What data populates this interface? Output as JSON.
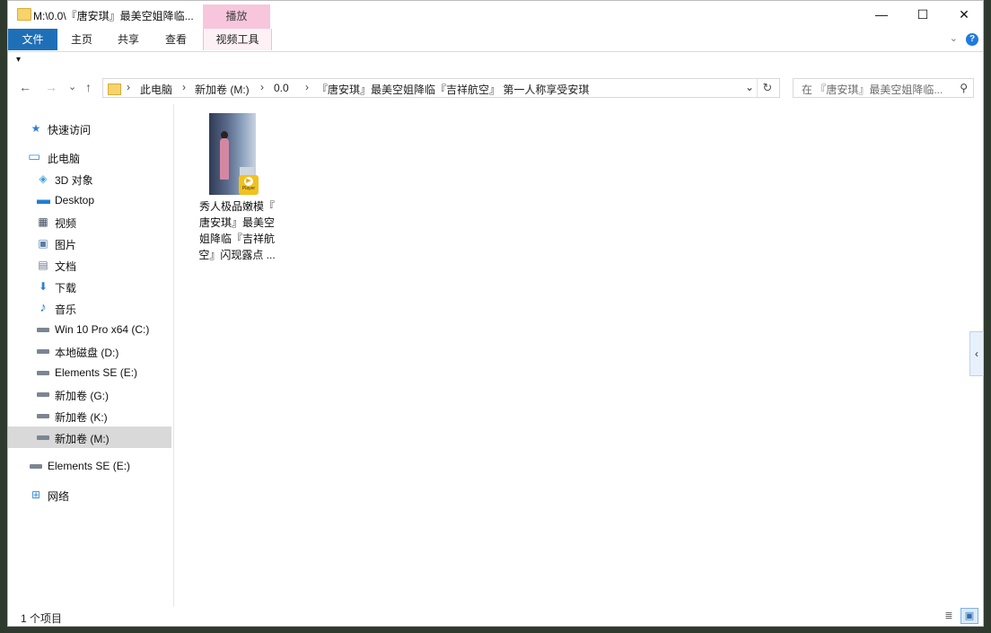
{
  "window": {
    "title": "M:\\0.0\\『唐安琪』最美空姐降临...",
    "context_tab": "播放",
    "controls": {
      "minimize": "—",
      "maximize": "☐",
      "close": "✕"
    }
  },
  "ribbon": {
    "tabs": [
      "文件",
      "主页",
      "共享",
      "查看"
    ],
    "context_tab": "视频工具",
    "expand_icon": "chevron-down-icon",
    "help": "?"
  },
  "qat": {
    "arrow": "▾"
  },
  "nav": {
    "back": "←",
    "forward": "→",
    "recent": "⌄",
    "up": "↑"
  },
  "address": {
    "breadcrumbs": [
      "此电脑",
      "新加卷 (M:)",
      "0.0",
      "『唐安琪』最美空姐降临『吉祥航空』 第一人称享受安琪"
    ],
    "separator": "›",
    "dropdown": "⌄",
    "refresh": "↻"
  },
  "search": {
    "placeholder": "在 『唐安琪』最美空姐降临...",
    "icon": "⚲"
  },
  "sidebar": {
    "items": [
      {
        "label": "快速访问",
        "icon": "star-icon",
        "glyph": "★",
        "color": "#2f7fd1"
      },
      {
        "label": "此电脑",
        "icon": "computer-icon",
        "glyph": "▭",
        "color": "#3b8fd8"
      },
      {
        "label": "3D 对象",
        "icon": "cube-icon",
        "glyph": "◈",
        "color": "#3aa0d8"
      },
      {
        "label": "Desktop",
        "icon": "desktop-icon",
        "glyph": "▬",
        "color": "#1e80d0"
      },
      {
        "label": "视频",
        "icon": "film-icon",
        "glyph": "▦",
        "color": "#3d4a5c"
      },
      {
        "label": "图片",
        "icon": "picture-icon",
        "glyph": "▣",
        "color": "#5a7ea6"
      },
      {
        "label": "文档",
        "icon": "document-icon",
        "glyph": "▤",
        "color": "#6a7a8c"
      },
      {
        "label": "下载",
        "icon": "download-icon",
        "glyph": "⬇",
        "color": "#2d7fd2"
      },
      {
        "label": "音乐",
        "icon": "music-icon",
        "glyph": "♪",
        "color": "#2d7fd2"
      },
      {
        "label": "Win 10 Pro x64 (C:)",
        "icon": "system-drive-icon",
        "glyph": "",
        "color": "#7c8593"
      },
      {
        "label": "本地磁盘 (D:)",
        "icon": "drive-icon",
        "glyph": "",
        "color": "#7c8593"
      },
      {
        "label": "Elements SE (E:)",
        "icon": "drive-icon",
        "glyph": "",
        "color": "#7c8593"
      },
      {
        "label": "新加卷 (G:)",
        "icon": "drive-icon",
        "glyph": "",
        "color": "#7c8593"
      },
      {
        "label": "新加卷 (K:)",
        "icon": "drive-icon",
        "glyph": "",
        "color": "#7c8593"
      },
      {
        "label": "新加卷 (M:)",
        "icon": "drive-icon",
        "glyph": "",
        "color": "#7c8593",
        "selected": true
      },
      {
        "label": "Elements SE (E:)",
        "icon": "drive-icon",
        "glyph": "",
        "color": "#7c8593"
      },
      {
        "label": "网络",
        "icon": "network-icon",
        "glyph": "⊞",
        "color": "#3b8fd8"
      }
    ]
  },
  "files": [
    {
      "name_lines": [
        "秀人极品嫩模『",
        "唐安琪』最美空",
        "姐降临『吉祥航",
        "空』闪现露点 ..."
      ],
      "badge_icon": "player-icon",
      "badge_text": "Player"
    }
  ],
  "side_tab": {
    "icon": "chevron-left-icon",
    "glyph": "‹"
  },
  "status": {
    "count": "1 个项目"
  },
  "views": {
    "details": "≣",
    "large": "▣"
  },
  "colors": {
    "accent": "#1f6fb7",
    "context_tab": "#f7c6dc",
    "selected_nav": "#d9d9d9",
    "badge": "#f2c11d"
  }
}
